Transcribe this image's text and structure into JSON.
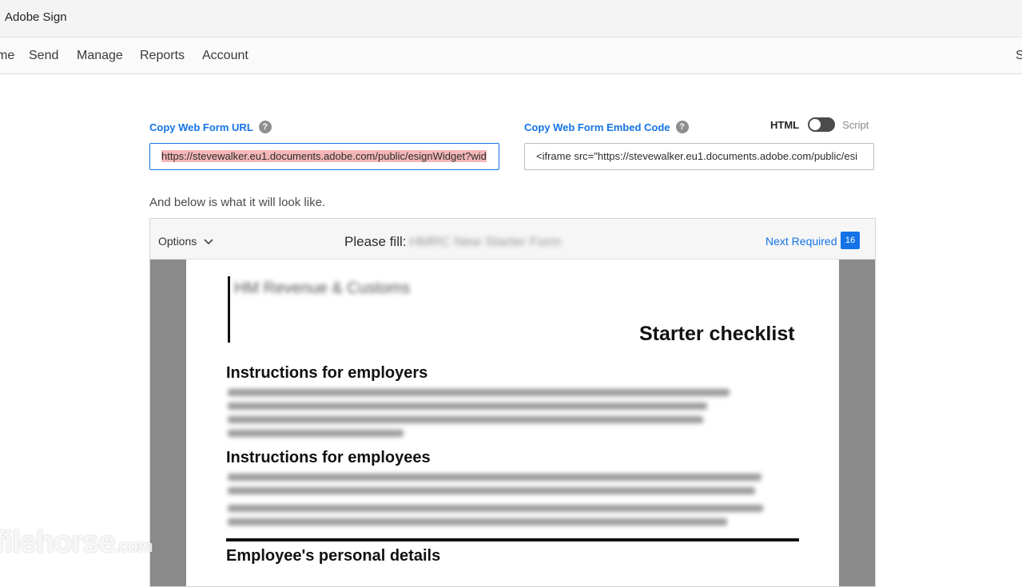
{
  "app": {
    "title": "Adobe Sign"
  },
  "nav": {
    "items": [
      "me",
      "Send",
      "Manage",
      "Reports",
      "Account"
    ],
    "right_partial": "S"
  },
  "web_form": {
    "url_label": "Copy Web Form URL",
    "url_value": "https://stevewalker.eu1.documents.adobe.com/public/esignWidget?wid",
    "embed_label": "Copy Web Form Embed Code",
    "embed_value": "<iframe src=\"https://stevewalker.eu1.documents.adobe.com/public/esi",
    "toggle_left": "HTML",
    "toggle_right": "Script",
    "help_icon_glyph": "?"
  },
  "preview": {
    "caption": "And below is what it will look like.",
    "options_label": "Options",
    "please_fill": "Please fill:",
    "form_name": "HMRC New Starter Form",
    "next_required": "Next Required",
    "next_required_count": "16",
    "document": {
      "logo_text": "HM Revenue & Customs",
      "title": "Starter checklist",
      "heading_employers": "Instructions for employers",
      "heading_employees": "Instructions for employees",
      "heading_personal": "Employee's personal details"
    }
  },
  "watermark": {
    "main": "filehorse",
    "suffix": ".com"
  },
  "colors": {
    "accent": "#1473e6",
    "selection": "#f4b7b7"
  },
  "icons": {
    "help": "help-icon",
    "chevron": "chevron-down-icon"
  }
}
